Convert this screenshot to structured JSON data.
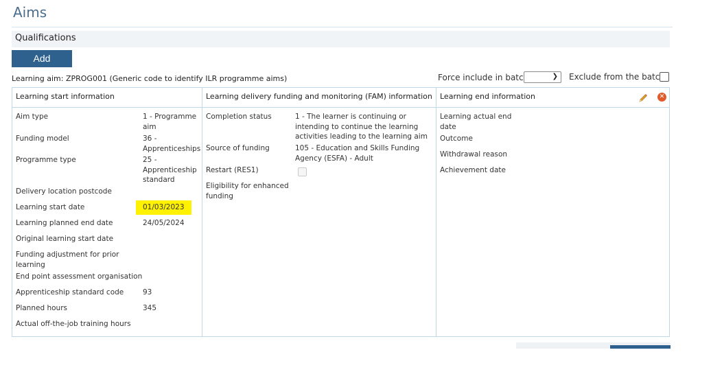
{
  "page": {
    "title": "Aims"
  },
  "qualifications": {
    "header": "Qualifications",
    "add_label": "Add"
  },
  "aim": {
    "label": "Learning aim: ZPROG001 (Generic code to identify ILR programme aims)"
  },
  "batch": {
    "force_label": "Force include in batch",
    "force_value": "",
    "exclude_label": "Exclude from the batch",
    "exclude_checked": false
  },
  "columns": {
    "start": {
      "header": "Learning start information",
      "rows": [
        {
          "label": "Aim type",
          "value": "1 - Programme aim"
        },
        {
          "label": "Funding model",
          "value": "36 - Apprenticeships"
        },
        {
          "label": "Programme type",
          "value": "25 - Apprenticeship standard"
        },
        {
          "label": "Delivery location postcode",
          "value": ""
        },
        {
          "label": "Learning start date",
          "value": "01/03/2023",
          "highlighted": true
        },
        {
          "label": "Learning planned end date",
          "value": "24/05/2024"
        },
        {
          "label": "Original learning start date",
          "value": ""
        },
        {
          "label": "Funding adjustment for prior learning",
          "value": ""
        },
        {
          "label": "End point assessment organisation",
          "value": ""
        },
        {
          "label": "Apprenticeship standard code",
          "value": "93"
        },
        {
          "label": "Planned hours",
          "value": "345"
        },
        {
          "label": "Actual off-the-job training hours",
          "value": ""
        }
      ]
    },
    "fam": {
      "header": "Learning delivery funding and monitoring (FAM) information",
      "rows": [
        {
          "label": "Completion status",
          "value": "1 - The learner is continuing or intending to continue the learning activities leading to the learning aim"
        },
        {
          "label": "Source of funding",
          "value": "105 - Education and Skills Funding Agency (ESFA) - Adult"
        },
        {
          "label": "Restart (RES1)",
          "value": "",
          "checked": false
        },
        {
          "label": "Eligibility for enhanced funding",
          "value": ""
        }
      ]
    },
    "end": {
      "header": "Learning end information",
      "rows": [
        {
          "label": "Learning actual end date"
        },
        {
          "label": "Outcome"
        },
        {
          "label": "Withdrawal reason"
        },
        {
          "label": "Achievement date"
        }
      ],
      "edit_icon": "pencil-icon",
      "close_icon": "close-circle-icon"
    }
  },
  "colors": {
    "accent": "#2f618f",
    "title": "#4a6d8c",
    "border": "#bfd8e8",
    "highlight": "#fff200",
    "close": "#e15a2b"
  }
}
